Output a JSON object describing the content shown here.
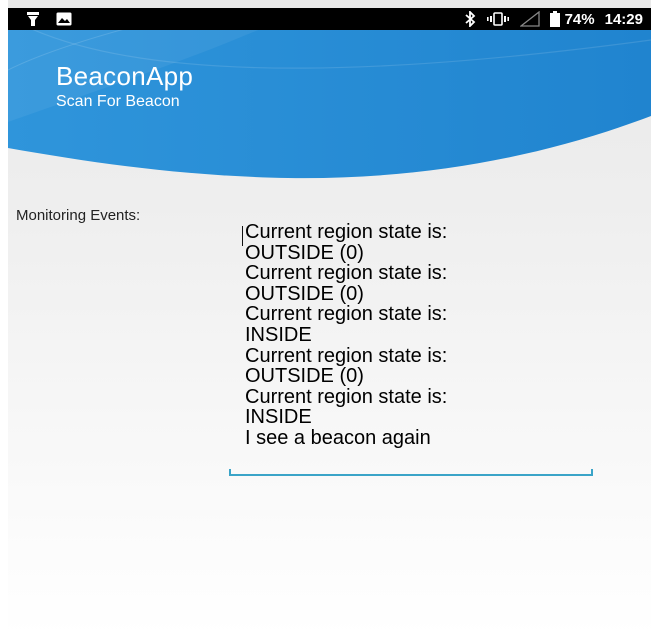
{
  "status_bar": {
    "battery_percent": "74%",
    "time": "14:29",
    "icons": [
      "flashlight-icon",
      "image-icon",
      "bluetooth-icon",
      "vibrate-icon",
      "signal-icon",
      "battery-icon"
    ]
  },
  "app": {
    "title": "BeaconApp",
    "subtitle": "Scan For Beacon",
    "header_color": "#2a8fd6"
  },
  "monitoring": {
    "label": "Monitoring Events:",
    "lines": [
      "Current region state is:",
      "OUTSIDE (0)",
      "Current region state is:",
      "OUTSIDE (0)",
      "Current region state is:",
      "INSIDE",
      "Current region state is:",
      "OUTSIDE (0)",
      "Current region state is:",
      "INSIDE",
      "I see a beacon again"
    ],
    "underline_color": "#3aa4c8"
  }
}
